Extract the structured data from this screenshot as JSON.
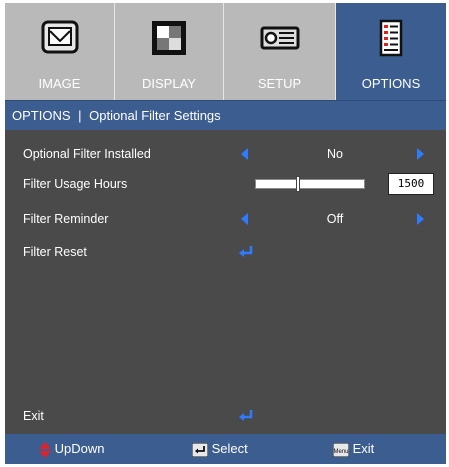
{
  "tabs": [
    {
      "label": "IMAGE",
      "icon": "image-icon",
      "active": false
    },
    {
      "label": "DISPLAY",
      "icon": "display-icon",
      "active": false
    },
    {
      "label": "SETUP",
      "icon": "projector-icon",
      "active": false
    },
    {
      "label": "OPTIONS",
      "icon": "options-icon",
      "active": true
    }
  ],
  "breadcrumb": {
    "section": "OPTIONS",
    "divider": "|",
    "page": "Optional Filter Settings"
  },
  "rows": {
    "filter_installed": {
      "label": "Optional Filter Installed",
      "value": "No"
    },
    "filter_usage_hours": {
      "label": "Filter Usage Hours",
      "value": "1500",
      "level": 0.38
    },
    "filter_reminder": {
      "label": "Filter Reminder",
      "value": "Off"
    },
    "filter_reset": {
      "label": "Filter Reset"
    },
    "exit": {
      "label": "Exit"
    }
  },
  "footer": {
    "updown": "UpDown",
    "select": "Select",
    "menu_key": "Menu",
    "exit": "Exit"
  },
  "colors": {
    "accent": "#3c5d8f",
    "panel": "#4a4a4a",
    "tab_inactive": "#b9b9b9",
    "arrow": "#2f7bff",
    "updown_icon": "#e0222a"
  }
}
